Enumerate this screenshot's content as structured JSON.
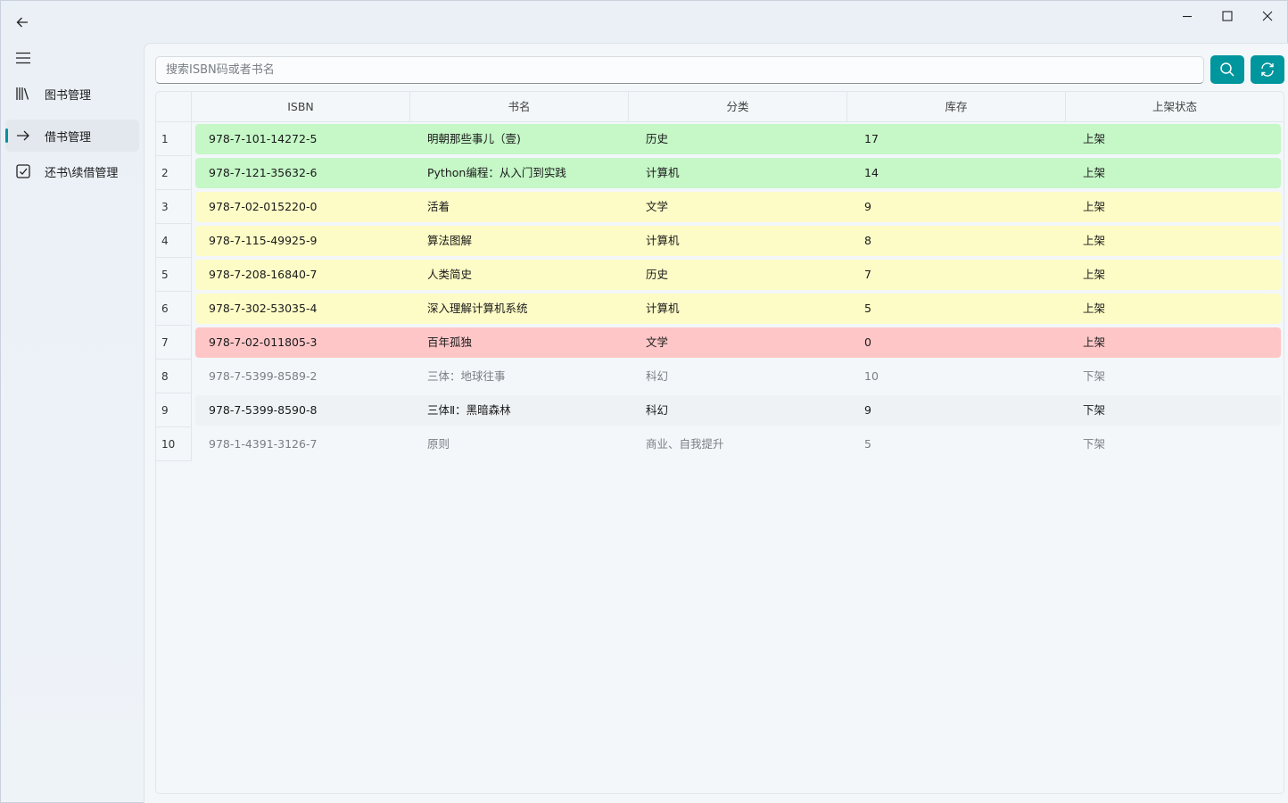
{
  "sidebar": {
    "items": [
      {
        "label": "图书管理",
        "icon": "library-icon",
        "active": false
      },
      {
        "label": "借书管理",
        "icon": "arrow-right-icon",
        "active": true
      },
      {
        "label": "还书\\续借管理",
        "icon": "checkbox-icon",
        "active": false
      }
    ]
  },
  "search": {
    "placeholder": "搜索ISBN码或者书名",
    "value": ""
  },
  "table": {
    "columns": [
      "ISBN",
      "书名",
      "分类",
      "库存",
      "上架状态"
    ],
    "rows": [
      {
        "num": "1",
        "isbn": "978-7-101-14272-5",
        "title": "明朝那些事儿（壹)",
        "category": "历史",
        "stock": "17",
        "status": "上架",
        "color": "green"
      },
      {
        "num": "2",
        "isbn": "978-7-121-35632-6",
        "title": "Python编程：从入门到实践",
        "category": "计算机",
        "stock": "14",
        "status": "上架",
        "color": "green"
      },
      {
        "num": "3",
        "isbn": "978-7-02-015220-0",
        "title": "活着",
        "category": "文学",
        "stock": "9",
        "status": "上架",
        "color": "yellow"
      },
      {
        "num": "4",
        "isbn": "978-7-115-49925-9",
        "title": "算法图解",
        "category": "计算机",
        "stock": "8",
        "status": "上架",
        "color": "yellow"
      },
      {
        "num": "5",
        "isbn": "978-7-208-16840-7",
        "title": "人类简史",
        "category": "历史",
        "stock": "7",
        "status": "上架",
        "color": "yellow"
      },
      {
        "num": "6",
        "isbn": "978-7-302-53035-4",
        "title": "深入理解计算机系统",
        "category": "计算机",
        "stock": "5",
        "status": "上架",
        "color": "yellow"
      },
      {
        "num": "7",
        "isbn": "978-7-02-011805-3",
        "title": "百年孤独",
        "category": "文学",
        "stock": "0",
        "status": "上架",
        "color": "red"
      },
      {
        "num": "8",
        "isbn": "978-7-5399-8589-2",
        "title": "三体：地球往事",
        "category": "科幻",
        "stock": "10",
        "status": "下架",
        "color": "plain"
      },
      {
        "num": "9",
        "isbn": "978-7-5399-8590-8",
        "title": "三体Ⅱ：黑暗森林",
        "category": "科幻",
        "stock": "9",
        "status": "下架",
        "color": "hover"
      },
      {
        "num": "10",
        "isbn": "978-1-4391-3126-7",
        "title": "原则",
        "category": "商业、自我提升",
        "stock": "5",
        "status": "下架",
        "color": "plain"
      }
    ]
  },
  "colors": {
    "accent": "#00969e",
    "row_green": "#c5f7c7",
    "row_yellow": "#fdfcc6",
    "row_red": "#ffc6c7"
  }
}
